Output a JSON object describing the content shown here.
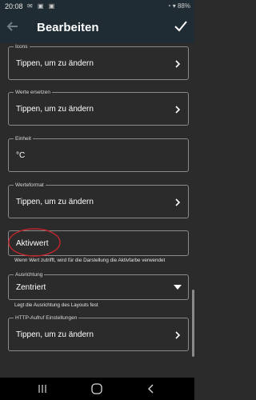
{
  "status_bar": {
    "time": "20:08",
    "left_icons": "✉ ▣ ▣",
    "right_icons": "◔ ▾ 88%"
  },
  "app_bar": {
    "title": "Bearbeiten"
  },
  "fields": {
    "icons": {
      "label": "Icons",
      "value": "Tippen, um zu ändern"
    },
    "werte_ersetzen": {
      "label": "Werte ersetzen",
      "value": "Tippen, um zu ändern"
    },
    "einheit": {
      "label": "Einheit",
      "value": "°C"
    },
    "werteformat": {
      "label": "Werteformat",
      "value": "Tippen, um zu ändern"
    },
    "aktivwert": {
      "value": "Aktivwert",
      "helper": "Wenn Wert zutrifft, wird für die Darstellung die Aktivfarbe verwendet"
    },
    "ausrichtung": {
      "label": "Ausrichtung",
      "value": "Zentriert",
      "helper": "Legt die Ausrichtung des Layouts fest"
    },
    "http_aufruf": {
      "label": "HTTP-Aufruf Einstellungen",
      "value": "Tippen, um zu ändern"
    }
  },
  "colors": {
    "appbar": "#1f2c33",
    "background": "#2b2b2b",
    "annotation": "#c0262c"
  },
  "icons": [
    "back-arrow-icon",
    "checkmark-icon",
    "chevron-right-icon",
    "dropdown-triangle-icon",
    "recent-apps-icon",
    "home-icon",
    "back-icon"
  ]
}
